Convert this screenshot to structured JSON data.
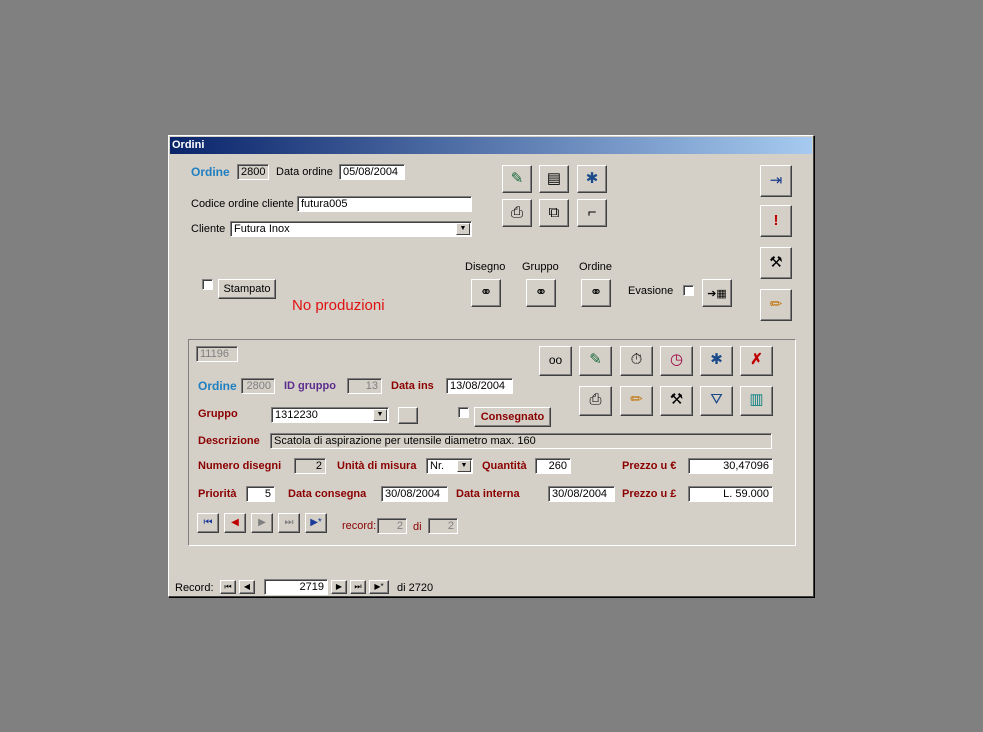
{
  "window": {
    "title": "Ordini"
  },
  "header": {
    "ordine_label": "Ordine",
    "ordine_value": "2800",
    "data_ordine_label": "Data ordine",
    "data_ordine_value": "05/08/2004",
    "codice_label": "Codice ordine cliente",
    "codice_value": "futura005",
    "cliente_label": "Cliente",
    "cliente_value": "Futura Inox",
    "stampato_label": "Stampato",
    "no_produzioni": "No produzioni",
    "disegno_label": "Disegno",
    "gruppo_label": "Gruppo",
    "ordine_search_label": "Ordine",
    "evasione_label": "Evasione"
  },
  "subform": {
    "id_value": "11196",
    "ordine_label": "Ordine",
    "ordine_value": "2800",
    "id_gruppo_label": "ID gruppo",
    "id_gruppo_value": "13",
    "data_ins_label": "Data ins",
    "data_ins_value": "13/08/2004",
    "gruppo_label": "Gruppo",
    "gruppo_value": "1312230",
    "consegnato_label": "Consegnato",
    "descrizione_label": "Descrizione",
    "descrizione_value": "Scatola di aspirazione per utensile diametro max. 160",
    "numero_disegni_label": "Numero disegni",
    "numero_disegni_value": "2",
    "unita_label": "Unità di misura",
    "unita_value": "Nr.",
    "quantita_label": "Quantità",
    "quantita_value": "260",
    "prezzo_euro_label": "Prezzo u €",
    "prezzo_euro_value": "30,47096",
    "priorita_label": "Priorità",
    "priorita_value": "5",
    "data_consegna_label": "Data consegna",
    "data_consegna_value": "30/08/2004",
    "data_interna_label": "Data interna",
    "data_interna_value": "30/08/2004",
    "prezzo_lira_label": "Prezzo u £",
    "prezzo_lira_value": "L. 59.000",
    "record_label": "record:",
    "record_value": "2",
    "di_label": "di",
    "di_value": "2"
  },
  "navigation": {
    "record_label": "Record:",
    "record_value": "2719",
    "total_label": "di 2720"
  },
  "icons": {
    "first": "⏮",
    "prev": "◀",
    "next": "▶",
    "last": "⏭",
    "new": "▶*"
  }
}
